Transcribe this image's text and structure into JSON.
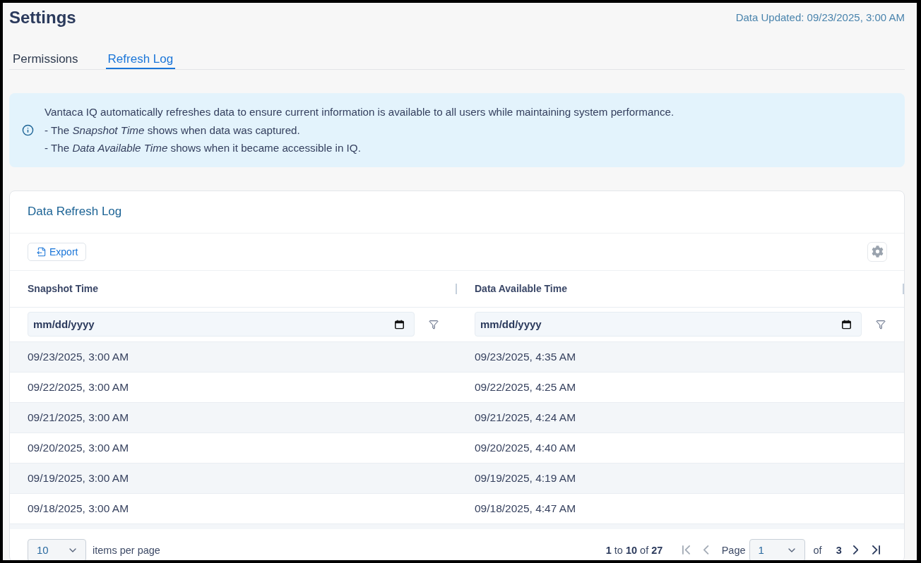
{
  "header": {
    "title": "Settings",
    "data_updated": "Data Updated: 09/23/2025, 3:00 AM"
  },
  "tabs": [
    {
      "label": "Permissions",
      "selected": false
    },
    {
      "label": "Refresh Log",
      "selected": true
    }
  ],
  "info_banner": {
    "lines": [
      "Vantaca IQ automatically refreshes data to ensure current information is available to all users while maintaining system performance.",
      "- The *Snapshot Time* shows when data was captured.",
      "- The *Data Available Time* shows when it became accessible in IQ."
    ]
  },
  "log_card": {
    "title": "Data Refresh Log",
    "export_button": "Export",
    "table": {
      "columns": [
        {
          "header": "Snapshot Time",
          "filter": {
            "placeholder": "mm/dd/yyyy"
          }
        },
        {
          "header": "Data Available Time",
          "filter": {
            "placeholder": "mm/dd/yyyy"
          }
        }
      ],
      "rows": [
        [
          "09/23/2025, 3:00 AM",
          "09/23/2025, 4:35 AM"
        ],
        [
          "09/22/2025, 3:00 AM",
          "09/22/2025, 4:25 AM"
        ],
        [
          "09/21/2025, 3:00 AM",
          "09/21/2025, 4:24 AM"
        ],
        [
          "09/20/2025, 3:00 AM",
          "09/20/2025, 4:40 AM"
        ],
        [
          "09/19/2025, 3:00 AM",
          "09/19/2025, 4:19 AM"
        ],
        [
          "09/18/2025, 3:00 AM",
          "09/18/2025, 4:47 AM"
        ]
      ]
    },
    "pagination": {
      "page_size": "10",
      "page_size_label": "items per page",
      "range": "**1** to **10** of **27**",
      "nav": [
        {
          "kind": "first",
          "disabled": true
        },
        {
          "kind": "previous",
          "disabled": true
        },
        {
          "kind": "next",
          "disabled": false
        },
        {
          "kind": "last",
          "disabled": false
        }
      ],
      "page_label": "Page",
      "page": "1",
      "of_label": "of",
      "page_count": "3"
    }
  }
}
